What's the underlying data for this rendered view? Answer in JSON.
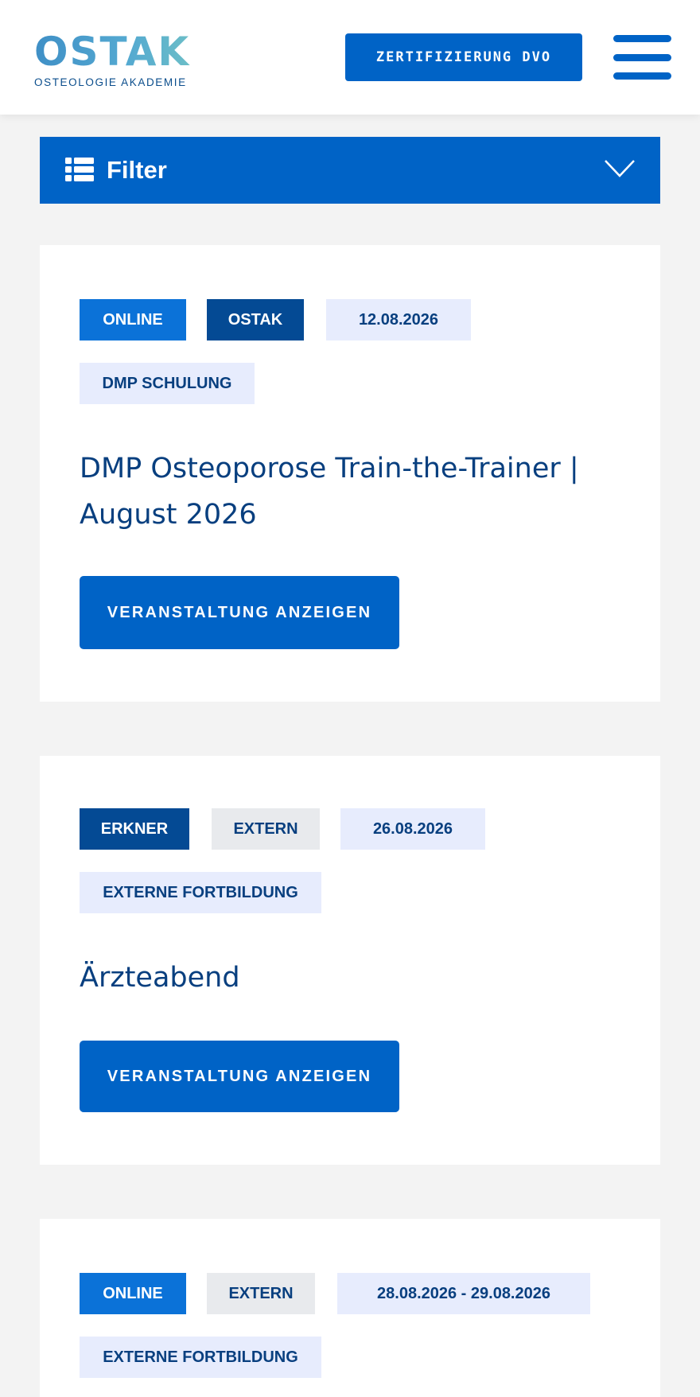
{
  "header": {
    "logo_mark": "OSTAK",
    "logo_sub": "OSTEOLOGIE AKADEMIE",
    "cert_button": "ZERTIFIZIERUNG DVO",
    "menu_icon": "hamburger-menu-icon"
  },
  "filter": {
    "label": "Filter",
    "icon": "list-icon",
    "toggle_icon": "chevron-down-icon"
  },
  "colors": {
    "primary": "#0063c6",
    "tag_blue": "#0b72d8",
    "tag_navy": "#044a94",
    "tag_lavender": "#e7ecfd",
    "tag_gray": "#e8eaed",
    "title": "#083f7f",
    "page_bg": "#f3f3f3"
  },
  "events": [
    {
      "tags": [
        "ONLINE",
        "OSTAK",
        "12.08.2026"
      ],
      "category": "DMP SCHULUNG",
      "title": "DMP Osteoporose Train-the-Trainer | August 2026",
      "button": "VERANSTALTUNG ANZEIGEN"
    },
    {
      "tags": [
        "ERKNER",
        "EXTERN",
        "26.08.2026"
      ],
      "category": "EXTERNE FORTBILDUNG",
      "title": "Ärzteabend",
      "button": "VERANSTALTUNG ANZEIGEN"
    },
    {
      "tags": [
        "ONLINE",
        "EXTERN",
        "28.08.2026 - 29.08.2026"
      ],
      "category": "EXTERNE FORTBILDUNG"
    }
  ]
}
